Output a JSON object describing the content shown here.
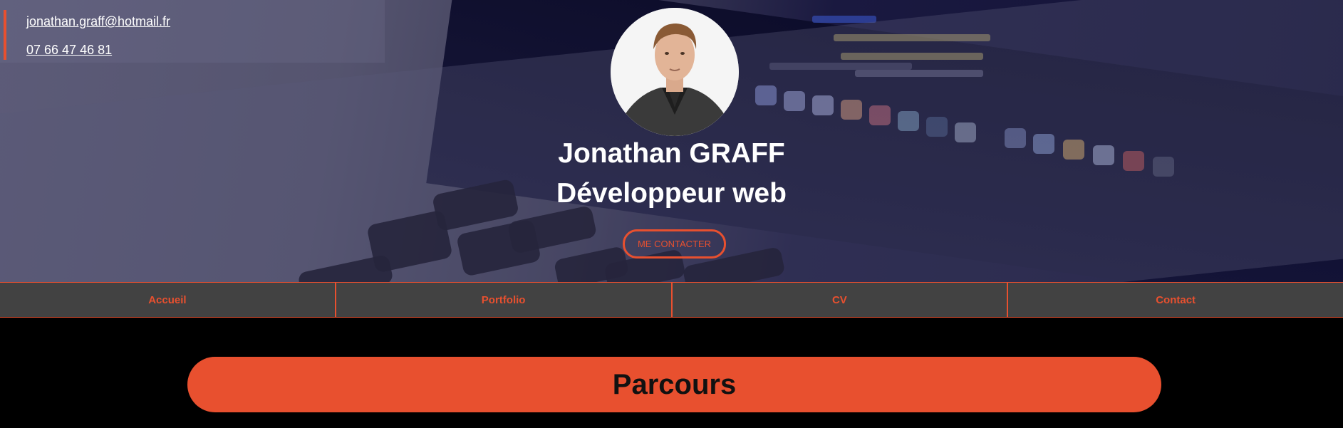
{
  "contact": {
    "email": "jonathan.graff@hotmail.fr",
    "phone": "07 66 47 46 81"
  },
  "hero": {
    "name": "Jonathan GRAFF",
    "role": "Développeur web",
    "cta_label": "ME CONTACTER"
  },
  "nav": {
    "items": [
      {
        "label": "Accueil"
      },
      {
        "label": "Portfolio"
      },
      {
        "label": "CV"
      },
      {
        "label": "Contact"
      }
    ]
  },
  "section": {
    "title": "Parcours"
  },
  "colors": {
    "accent": "#e8502f",
    "nav_bg": "#424242",
    "page_bg": "#000000",
    "text_light": "#ffffff"
  },
  "icons": {
    "avatar": "profile-photo"
  }
}
